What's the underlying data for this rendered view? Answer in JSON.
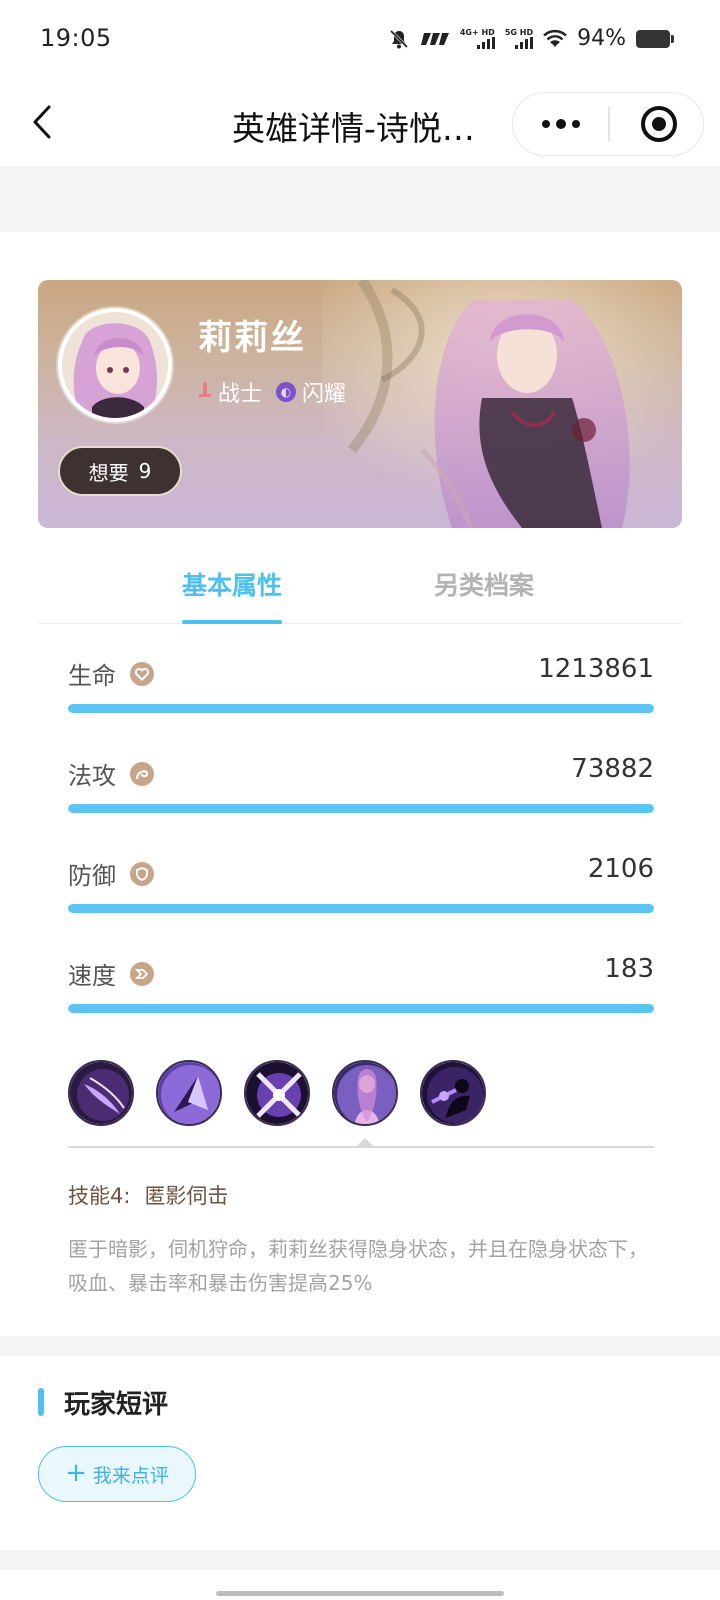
{
  "status_bar": {
    "time": "19:05",
    "network_1": "4G+ HD",
    "network_2": "5G HD",
    "battery": "94%"
  },
  "nav": {
    "title": "英雄详情-诗悦…"
  },
  "hero": {
    "name": "莉莉丝",
    "class_tag": "战士",
    "element_tag": "闪耀",
    "want_label": "想要",
    "want_count": "9"
  },
  "tabs": {
    "basic": "基本属性",
    "alt": "另类档案"
  },
  "stats": [
    {
      "label": "生命",
      "value": "1213861",
      "icon": "heart-icon",
      "fill": 1.0
    },
    {
      "label": "法攻",
      "value": "73882",
      "icon": "magic-attack-icon",
      "fill": 1.0
    },
    {
      "label": "防御",
      "value": "2106",
      "icon": "shield-icon",
      "fill": 1.0
    },
    {
      "label": "速度",
      "value": "183",
      "icon": "speed-icon",
      "fill": 1.0
    }
  ],
  "skills": {
    "icons": [
      "skill-1-icon",
      "skill-2-icon",
      "skill-3-icon",
      "skill-4-icon",
      "skill-5-icon"
    ],
    "selected_index": 4,
    "title_prefix": "技能4:",
    "title_name": "匿影伺击",
    "description": "匿于暗影，伺机狩命，莉莉丝获得隐身状态，并且在隐身状态下，吸血、暴击率和暴击伤害提高25%"
  },
  "reviews": {
    "section_title": "玩家短评",
    "button_label": "我来点评"
  },
  "colors": {
    "accent": "#4dbff0",
    "bar": "#5cc4f2",
    "want_button": "#3d3131",
    "stat_icon": "#c6a68a"
  }
}
